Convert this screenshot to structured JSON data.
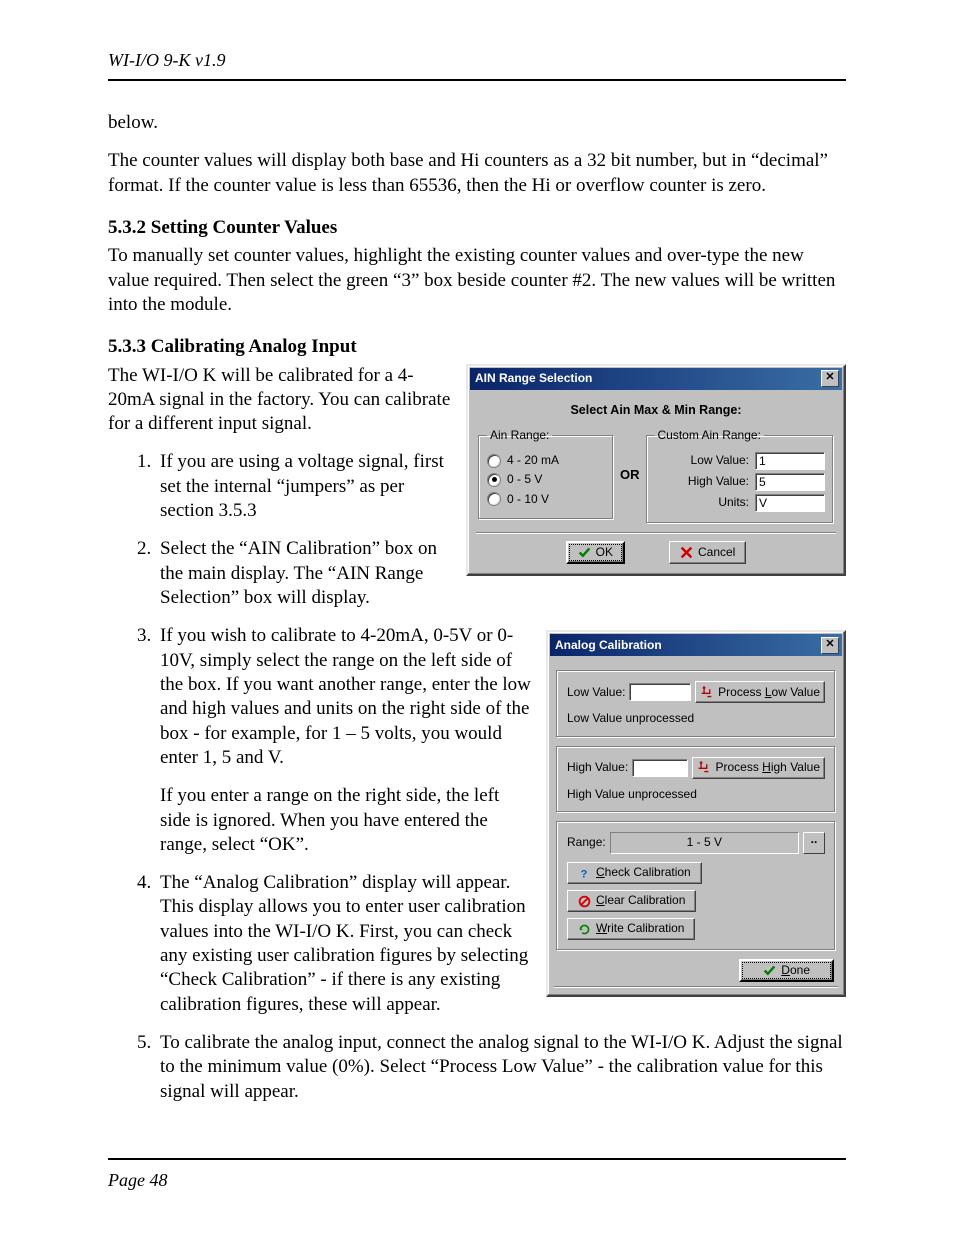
{
  "doc": {
    "running_head": "WI-I/O 9-K v1.9",
    "page_label": "Page 48",
    "p_below": "below.",
    "p_counter": "The counter values will display both base and Hi counters as a 32 bit number,  but in “decimal” format.  If the counter value is less than 65536,  then the Hi or overflow counter is zero.",
    "h_532": "5.3.2   Setting Counter Values",
    "p_532": "To manually set counter values,  highlight the existing counter values and over-type the new value required. Then select the green “3” box beside counter #2.  The new values will be written into the module.",
    "h_533": "5.3.3   Calibrating Analog Input",
    "p_533_intro": "The WI-I/O K will be calibrated for a 4-20mA signal in the factory.  You can calibrate for a different input signal.",
    "steps": [
      "If you are using a voltage signal,  first set the internal “jumpers” as per section 3.5.3",
      "Select the “AIN Calibration” box on the main display.  The “AIN Range Selection” box will display.",
      "If you wish to calibrate to 4-20mA, 0-5V or 0-10V,  simply select the range on the left side of the box.  If you want another range,  enter the low and high values and units on the right side of the box  -  for example,  for 1 – 5 volts,  you would enter 1, 5 and V.",
      "The “Analog Calibration” display will appear.  This display allows you to enter user calibration values into the WI-I/O K. First,  you can check any existing user calibration figures by selecting “Check Calibration”  -  if there is any existing calibration figures,  these will appear.",
      "To calibrate the analog input,  connect the analog signal to the WI-I/O K.  Adjust the signal to the minimum value (0%).  Select “Process Low Value”  -  the calibration value for this signal will appear."
    ],
    "p_step3_followup": "If you enter a range on the right side,  the left side is ignored.  When you have entered the range,  select “OK”."
  },
  "dlg1": {
    "title": "AIN Range Selection",
    "heading": "Select Ain Max & Min Range:",
    "range_legend": "Ain Range:",
    "custom_legend": "Custom Ain Range:",
    "or": "OR",
    "opts": {
      "a": "4  -  20 mA",
      "b": "0  -   5 V",
      "c": "0  -  10 V"
    },
    "low_label": "Low Value:",
    "high_label": "High Value:",
    "units_label": "Units:",
    "low_value": "1",
    "high_value": "5",
    "units_value": "V",
    "ok": "OK",
    "cancel": "Cancel"
  },
  "dlg2": {
    "title": "Analog Calibration",
    "low_label": "Low Value:",
    "high_label": "High Value:",
    "low_status": "Low Value unprocessed",
    "high_status": "High Value unprocessed",
    "process_low_pre": "Process ",
    "process_low_u": "L",
    "process_low_post": "ow Value",
    "process_high_pre": "Process ",
    "process_high_u": "H",
    "process_high_post": "igh Value",
    "range_label": "Range:",
    "range_value": "1 - 5 V",
    "check_u": "C",
    "check_post": "heck Calibration",
    "clear_u": "C",
    "clear_post": "lear Calibration",
    "write_u": "W",
    "write_post": "rite Calibration",
    "done_u": "D",
    "done_post": "one"
  }
}
